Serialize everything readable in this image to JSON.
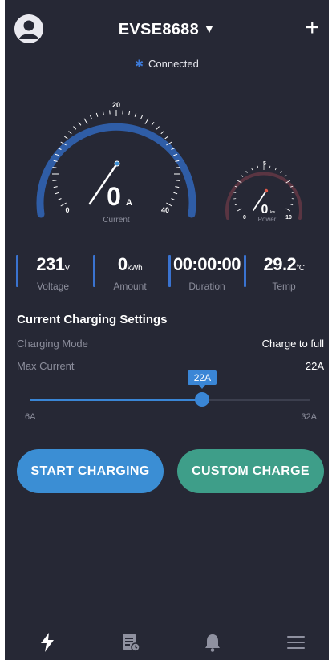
{
  "header": {
    "device_name": "EVSE8688",
    "caret": "▼",
    "add_label": "+",
    "connection_status": "Connected",
    "bluetooth_glyph": "✱"
  },
  "gauges": {
    "current": {
      "value": "0",
      "unit": "A",
      "label": "Current",
      "ticks": [
        "0",
        "20",
        "40"
      ],
      "min": 0,
      "max": 40,
      "reading": 0
    },
    "power": {
      "value": "0",
      "unit": "kw",
      "label": "Power",
      "ticks": [
        "0",
        "5",
        "10"
      ],
      "min": 0,
      "max": 10,
      "reading": 0
    }
  },
  "stats": [
    {
      "value": "231",
      "unit": "V",
      "label": "Voltage"
    },
    {
      "value": "0",
      "unit": "kWh",
      "label": "Amount"
    },
    {
      "value": "00:00:00",
      "unit": "",
      "label": "Duration"
    },
    {
      "value": "29.2",
      "unit": "°C",
      "label": "Temp"
    }
  ],
  "settings": {
    "title": "Current Charging Settings",
    "mode_label": "Charging Mode",
    "mode_value": "Charge to full",
    "max_label": "Max Current",
    "max_value": "22A",
    "slider": {
      "min_label": "6A",
      "max_label": "32A",
      "tooltip": "22A",
      "min": 6,
      "max": 32,
      "value": 22
    }
  },
  "buttons": {
    "start": "START CHARGING",
    "custom": "CUSTOM CHARGE"
  },
  "nav": {
    "items": [
      {
        "icon": "lightning-icon",
        "active": true
      },
      {
        "icon": "records-icon",
        "active": false
      },
      {
        "icon": "bell-icon",
        "active": false
      },
      {
        "icon": "menu-icon",
        "active": false
      }
    ]
  },
  "colors": {
    "background": "#262835",
    "accent_blue": "#3b8ed4",
    "accent_green": "#3e9e89",
    "gauge_ring": "#2f5da6",
    "power_ring": "#5a3542",
    "needle_glow": "#e05b4c"
  }
}
